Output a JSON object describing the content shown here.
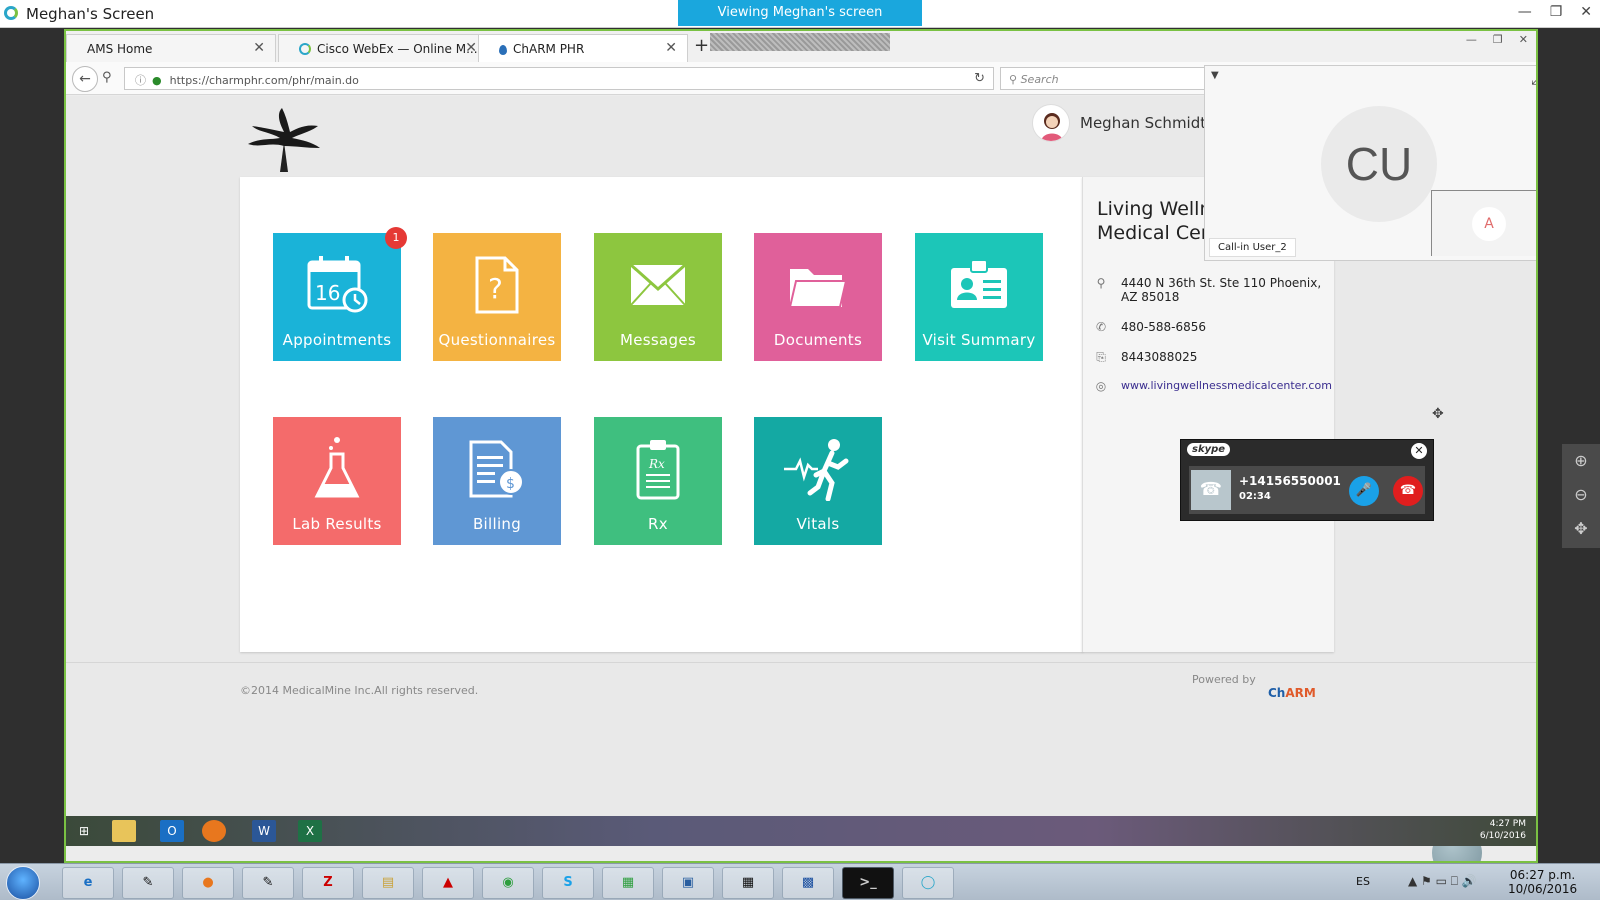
{
  "host": {
    "window_title": "Meghan's Screen",
    "viewing_banner": "Viewing Meghan's screen"
  },
  "browser": {
    "tabs": [
      {
        "label": "AMS Home"
      },
      {
        "label": "Cisco WebEx — Online M..."
      },
      {
        "label": "ChARM PHR"
      }
    ],
    "url_host": "https://charmphr.com",
    "url_path": "/phr/main.do",
    "search_placeholder": "Search"
  },
  "page": {
    "user_name": "Meghan Schmidt",
    "tiles": [
      {
        "label": "Appointments",
        "color": "#1ab3d8",
        "badge": "1",
        "icon": "calendar-icon",
        "icon_text": "16"
      },
      {
        "label": "Questionnaires",
        "color": "#f4b342",
        "icon": "question-document-icon",
        "icon_text": "?"
      },
      {
        "label": "Messages",
        "color": "#8dc63f",
        "icon": "envelope-icon"
      },
      {
        "label": "Documents",
        "color": "#e0609a",
        "icon": "folder-icon"
      },
      {
        "label": "Visit Summary",
        "color": "#1cc6b8",
        "icon": "id-card-icon"
      },
      {
        "label": "Lab Results",
        "color": "#f46b6b",
        "icon": "flask-icon"
      },
      {
        "label": "Billing",
        "color": "#5f97d4",
        "icon": "bill-icon"
      },
      {
        "label": "Rx",
        "color": "#3fbf7f",
        "icon": "prescription-icon",
        "icon_text": "Rx"
      },
      {
        "label": "Vitals",
        "color": "#14a9a3",
        "icon": "running-heartbeat-icon"
      }
    ],
    "clinic": {
      "name_line1": "Living Welln",
      "name_line2": "Medical Cer",
      "address": "4440 N 36th St. Ste 110 Phoenix, AZ 85018",
      "phone": "480-588-6856",
      "fax": "8443088025",
      "website": "www.livingwellnessmedicalcenter.com"
    },
    "footer": {
      "copyright": "©2014 MedicalMine Inc.All rights reserved.",
      "powered_by": "Powered by",
      "brand_ch": "Ch",
      "brand_arm": "ARM"
    }
  },
  "video_panel": {
    "initials": "CU",
    "callin_label": "Call-in User_2",
    "pip_initial": "A"
  },
  "skype_call": {
    "brand": "skype",
    "number": "+14156550001",
    "duration": "02:34"
  },
  "inner_taskbar": {
    "time": "4:27 PM",
    "date": "6/10/2016"
  },
  "taskbar": {
    "language": "ES",
    "time": "06:27 p.m.",
    "date": "10/06/2016",
    "apps": [
      "ie",
      "screenshot",
      "firefox",
      "notepad",
      "filezilla",
      "explorer",
      "acrobat",
      "chrome",
      "skype",
      "calc-sheet",
      "virtualbox",
      "calculator",
      "remote",
      "cmd",
      "webex"
    ]
  },
  "colors": {
    "accent_banner": "#1aa7dd",
    "share_border": "#7ac143"
  }
}
